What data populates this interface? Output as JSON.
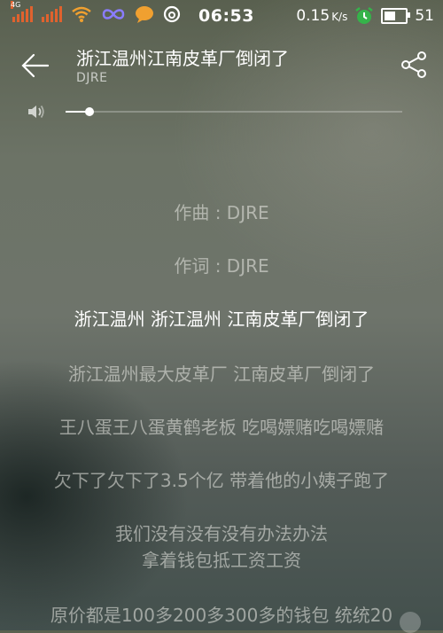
{
  "status_bar": {
    "network_tag": "4G",
    "time": "06:53",
    "speed": "0.15",
    "speed_unit": "K/s",
    "battery": "51",
    "battery_level": 0.51
  },
  "header": {
    "title": "浙江温州江南皮革厂倒闭了",
    "artist": "DJRE"
  },
  "volume": {
    "level": 0.07
  },
  "lyrics": [
    {
      "text": "作曲 : DJRE",
      "active": false
    },
    {
      "text": "作词 : DJRE",
      "active": false
    },
    {
      "text": "浙江温州 浙江温州 江南皮革厂倒闭了",
      "active": true
    },
    {
      "text": "浙江温州最大皮革厂 江南皮革厂倒闭了",
      "active": false
    },
    {
      "text": "王八蛋王八蛋黄鹤老板 吃喝嫖赌吃喝嫖赌",
      "active": false
    },
    {
      "text": "欠下了欠下了3.5个亿 带着他的小姨子跑了",
      "active": false
    },
    {
      "text": "我们没有没有没有办法办法",
      "active": false
    },
    {
      "text": "拿着钱包抵工资工资",
      "active": false
    },
    {
      "text": "原价都是100多200多300多的钱包 统统20",
      "active": false
    }
  ],
  "icons": [
    "signal-icon",
    "wifi-icon",
    "infinity-icon",
    "chat-bubble-icon",
    "netease-icon",
    "alarm-icon",
    "battery-icon",
    "back-arrow-icon",
    "share-icon",
    "speaker-icon",
    "more-icon"
  ],
  "colors": {
    "signal": "#e0622e",
    "alarm": "#35b34a",
    "chat": "#f0a030"
  }
}
